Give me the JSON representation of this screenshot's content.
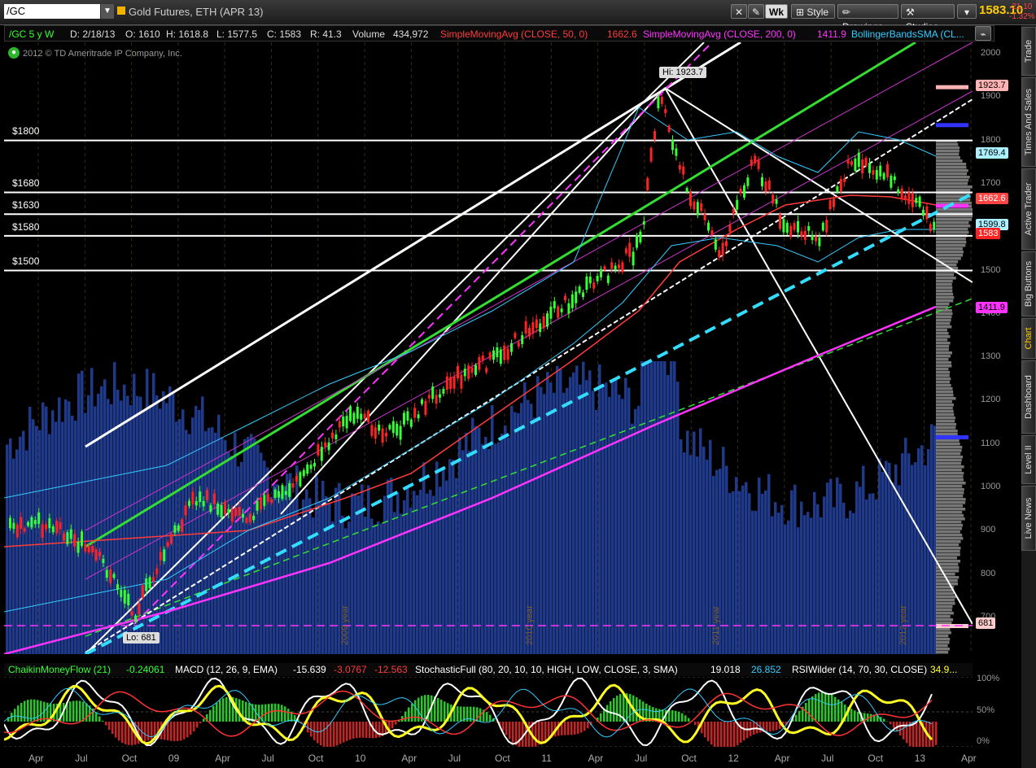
{
  "toolbar": {
    "symbol": "/GC",
    "instrument_title": "Gold Futures, ETH (APR 13)",
    "aggregation_label": "Wk",
    "style_label": "Style",
    "drawings_label": "Drawings",
    "studies_label": "Studies",
    "last_price": "1583.10",
    "net_change": "-21.10",
    "pct_change": "-1.32%"
  },
  "infobar": {
    "symbol_period": "/GC 5 y W",
    "date": "D: 2/18/13",
    "open": "O: 1610",
    "high": "H: 1618.8",
    "low": "L: 1577.5",
    "close": "C: 1583",
    "range": "R: 41.3",
    "volume_label": "Volume",
    "volume_value": "434,972",
    "sma50_label": "SimpleMovingAvg (CLOSE, 50, 0)",
    "sma50_value": "1662.6",
    "sma200_label": "SimpleMovingAvg (CLOSE, 200, 0)",
    "sma200_value": "1411.9",
    "bb_label": "BollingerBandsSMA (CL..."
  },
  "copyright": "2012 © TD Ameritrade IP Company, Inc.",
  "sidebar_tabs": [
    "Trade",
    "Times And Sales",
    "Active Trader",
    "Big Buttons",
    "Chart",
    "Dashboard",
    "Level II",
    "Live News"
  ],
  "active_tab": "Chart",
  "level_labels": [
    "$1800",
    "$1680",
    "$1630",
    "$1580",
    "$1500"
  ],
  "hi_label": "Hi: 1923.7",
  "lo_label": "Lo: 681",
  "price_tags": {
    "hi": "1923.7",
    "bb_upper": "1769.4",
    "sma50": "1662.6",
    "bb_lower": "1599.8",
    "last": "1583",
    "sma200": "1411.9",
    "lo": "681"
  },
  "price_axis": [
    "2000",
    "1900",
    "1800",
    "1700",
    "1600",
    "1500",
    "1400",
    "1300",
    "1200",
    "1100",
    "1000",
    "900",
    "800",
    "700"
  ],
  "year_labels": [
    "2009 year",
    "2010 year",
    "2011 year",
    "2012 year"
  ],
  "months": [
    "Apr",
    "Jul",
    "Oct",
    "09",
    "Apr",
    "Jul",
    "Oct",
    "10",
    "Apr",
    "Jul",
    "Oct",
    "11",
    "Apr",
    "Jul",
    "Oct",
    "12",
    "Apr",
    "Jul",
    "Oct",
    "13",
    "Apr"
  ],
  "lower_info": {
    "cmf_label": "ChaikinMoneyFlow (21)",
    "cmf_value": "-0.24061",
    "macd_label": "MACD (12, 26, 9, EMA)",
    "macd_v1": "-15.639",
    "macd_v2": "-3.0767",
    "macd_v3": "-12.563",
    "stoch_label": "StochasticFull (80, 20, 10, 10, HIGH, LOW, CLOSE, 3, SMA)",
    "stoch_v1": "19.018",
    "stoch_v2": "26.852",
    "rsi_label": "RSIWilder (14, 70, 30, CLOSE)",
    "rsi_value": "34.9..."
  },
  "lower_axis": [
    "100%",
    "50%",
    "0%"
  ],
  "colors": {
    "sma50": "#ff3b3b",
    "sma200": "#ff33ff",
    "bollinger": "#33ccff",
    "volume": "#1f3a8a",
    "up_candle": "#33ff33",
    "down_candle": "#ff2222"
  }
}
